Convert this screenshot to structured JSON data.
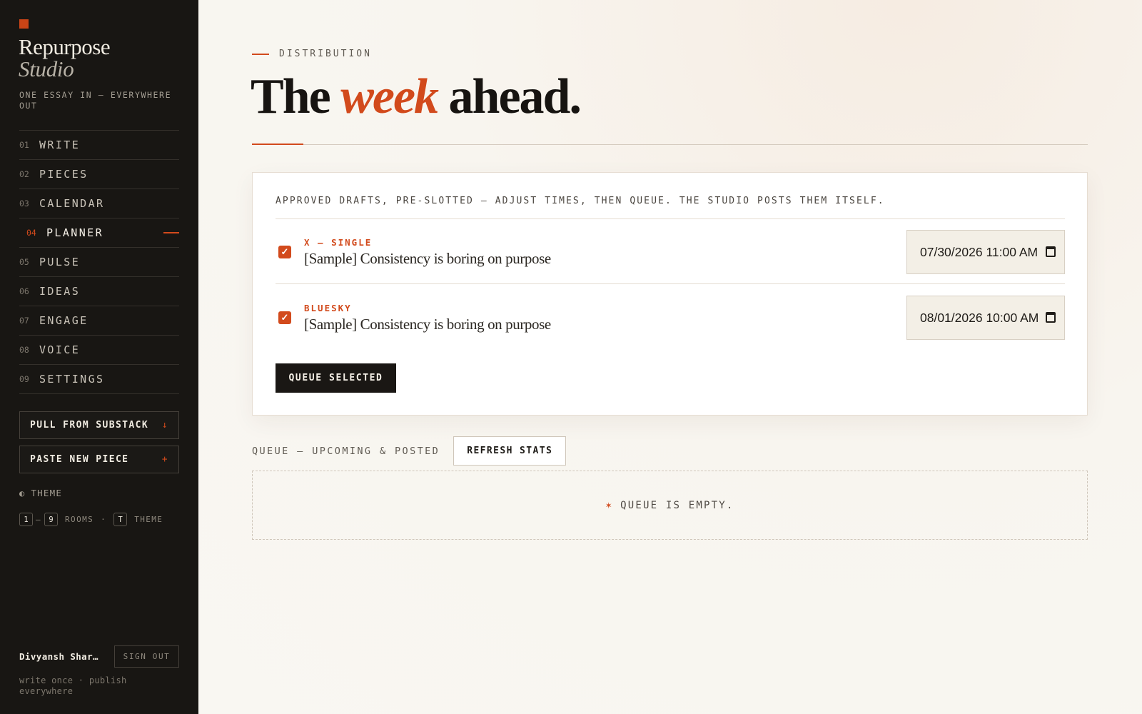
{
  "sidebar": {
    "brand_line1": "Repurpose",
    "brand_line2": "Studio",
    "tagline": "ONE ESSAY IN — EVERYWHERE OUT",
    "nav": [
      {
        "num": "01",
        "label": "WRITE"
      },
      {
        "num": "02",
        "label": "PIECES"
      },
      {
        "num": "03",
        "label": "CALENDAR"
      },
      {
        "num": "04",
        "label": "PLANNER",
        "active": true
      },
      {
        "num": "05",
        "label": "PULSE"
      },
      {
        "num": "06",
        "label": "IDEAS"
      },
      {
        "num": "07",
        "label": "ENGAGE"
      },
      {
        "num": "08",
        "label": "VOICE"
      },
      {
        "num": "09",
        "label": "SETTINGS"
      }
    ],
    "pull_button": {
      "label": "PULL FROM SUBSTACK",
      "glyph": "↓"
    },
    "paste_button": {
      "label": "PASTE NEW PIECE",
      "glyph": "+"
    },
    "theme_icon": "half-circle-icon",
    "theme_label": "THEME",
    "shortcuts": {
      "key1": "1",
      "sep": "–",
      "key2": "9",
      "rooms": "ROOMS",
      "dot": "·",
      "key3": "T",
      "theme": "THEME"
    },
    "user_name": "Divyansh Shar…",
    "sign_out": "SIGN OUT",
    "footer": "write once · publish everywhere"
  },
  "main": {
    "eyebrow": "DISTRIBUTION",
    "title_pre": "The ",
    "title_accent": "week",
    "title_post": " ahead.",
    "intro": "APPROVED DRAFTS, PRE-SLOTTED — ADJUST TIMES, THEN QUEUE. THE STUDIO POSTS THEM ITSELF.",
    "drafts": [
      {
        "network": "X — SINGLE",
        "title": "[Sample] Consistency is boring on purpose",
        "checked": true,
        "datetime": "07/30/2026 11:00 AM"
      },
      {
        "network": "BLUESKY",
        "title": "[Sample] Consistency is boring on purpose",
        "checked": true,
        "datetime": "08/01/2026 10:00 AM"
      }
    ],
    "queue_button": "QUEUE SELECTED",
    "queue_heading": "QUEUE — UPCOMING & POSTED",
    "refresh_button": "REFRESH STATS",
    "empty_star": "✶",
    "empty_text": "QUEUE IS EMPTY."
  },
  "colors": {
    "accent": "#d24a1c",
    "sidebar_bg": "#181613",
    "page_bg": "#f8f5ef"
  }
}
